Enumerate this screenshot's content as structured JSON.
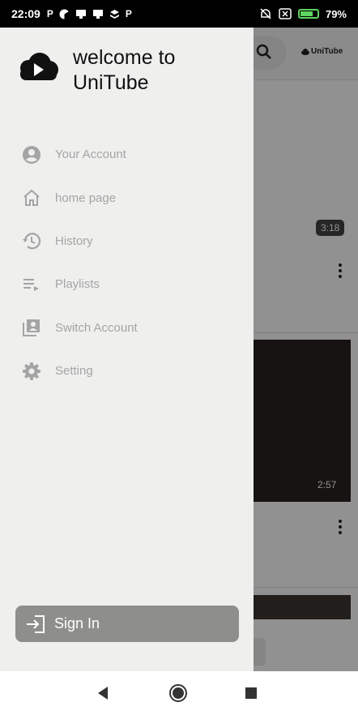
{
  "status_bar": {
    "time": "22:09",
    "notification_icons": [
      "P",
      "pie-chart-icon",
      "cast-icon",
      "cast-icon",
      "layers-icon",
      "P"
    ],
    "battery_percent": "79%",
    "battery_level": 0.79
  },
  "background_app": {
    "logo_text": "UniTube",
    "video_durations": [
      "3:18",
      "2:57"
    ]
  },
  "drawer": {
    "title": "welcome to UniTube",
    "menu": [
      {
        "label": "Your Account",
        "icon": "account-circle-icon"
      },
      {
        "label": "home page",
        "icon": "home-icon"
      },
      {
        "label": "History",
        "icon": "history-icon"
      },
      {
        "label": "Playlists",
        "icon": "playlist-icon"
      },
      {
        "label": "Switch Account",
        "icon": "switch-account-icon"
      },
      {
        "label": "Setting",
        "icon": "gear-icon"
      }
    ],
    "sign_in_label": "Sign In"
  },
  "colors": {
    "drawer_bg": "#eff0ee",
    "menu_text": "#a4a4a4",
    "sign_in_bg": "#8e8f8c",
    "battery": "#5fd35f"
  }
}
